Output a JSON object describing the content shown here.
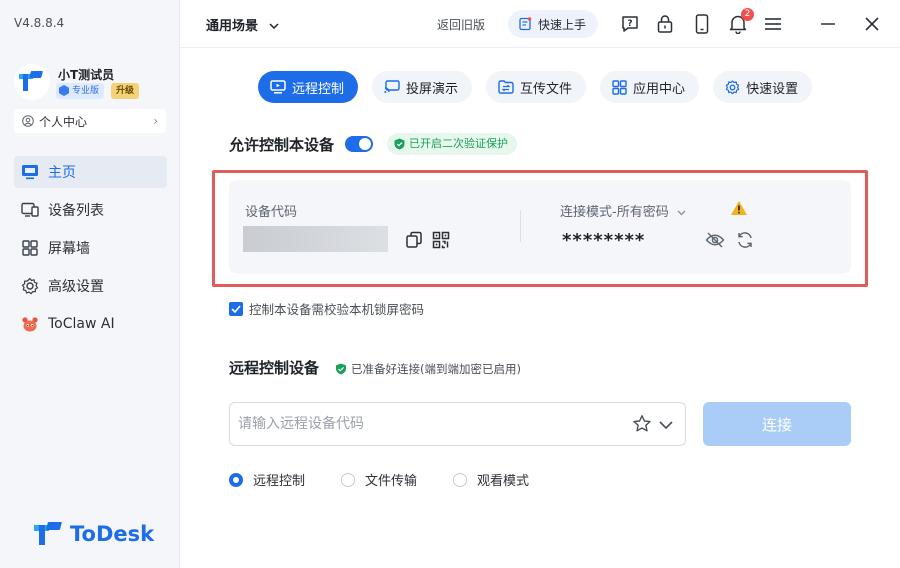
{
  "app": {
    "version": "V4.8.8.4",
    "logo_text": "ToDesk",
    "brand_color": "#1d6ce8"
  },
  "user": {
    "name": "小T测试员",
    "tier_badge": "专业版",
    "upgrade_label": "升级",
    "personal_center": "个人中心"
  },
  "sidebar": {
    "items": [
      {
        "label": "主页",
        "icon": "monitor-icon",
        "active": true
      },
      {
        "label": "设备列表",
        "icon": "device-list-icon",
        "active": false
      },
      {
        "label": "屏幕墙",
        "icon": "grid-icon",
        "active": false
      },
      {
        "label": "高级设置",
        "icon": "gear-icon",
        "active": false
      },
      {
        "label": "ToClaw AI",
        "icon": "toclaw-icon",
        "active": false
      }
    ]
  },
  "header": {
    "scene_label": "通用场景",
    "old_version": "返回旧版",
    "quick_start": "快速上手",
    "notification_count": "2"
  },
  "tabs": [
    {
      "label": "远程控制",
      "icon": "remote-control-icon",
      "active": true
    },
    {
      "label": "投屏演示",
      "icon": "cast-icon",
      "active": false
    },
    {
      "label": "互传文件",
      "icon": "file-transfer-icon",
      "active": false
    },
    {
      "label": "应用中心",
      "icon": "app-center-icon",
      "active": false
    },
    {
      "label": "快速设置",
      "icon": "settings-icon",
      "active": false
    }
  ],
  "allow_control": {
    "title": "允许控制本设备",
    "enabled": true,
    "verify_badge": "已开启二次验证保护",
    "device_code_label": "设备代码",
    "connect_mode_label": "连接模式-所有密码",
    "password_masked": "********",
    "lock_check_label": "控制本设备需校验本机锁屏密码",
    "lock_check_checked": true
  },
  "remote": {
    "title": "远程控制设备",
    "ready_status": "已准备好连接(端到端加密已启用)",
    "input_placeholder": "请输入远程设备代码",
    "input_value": "",
    "connect_button": "连接",
    "modes": [
      {
        "label": "远程控制",
        "checked": true
      },
      {
        "label": "文件传输",
        "checked": false
      },
      {
        "label": "观看模式",
        "checked": false
      }
    ]
  }
}
